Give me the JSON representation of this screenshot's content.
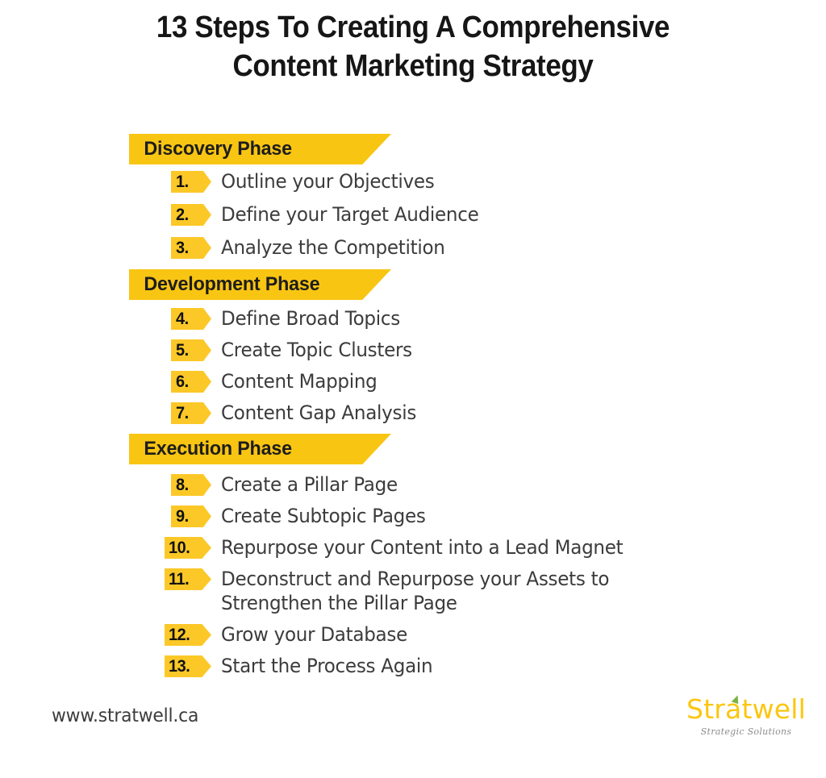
{
  "title": {
    "line1": "13 Steps To Creating A Comprehensive",
    "line2": "Content Marketing Strategy"
  },
  "colors": {
    "banner_yellow": "#F9C513",
    "badge_yellow": "#FCC828",
    "title_black": "#161616",
    "body_gray": "#3C3C3E",
    "logo_gold": "#FAC711",
    "logo_leaf_green": "#7CB342",
    "tagline_gray": "#8D8D8D",
    "background": "#FFFFFF"
  },
  "phases": [
    {
      "label": "Discovery Phase",
      "steps": [
        {
          "num": "1.",
          "text": "Outline your Objectives"
        },
        {
          "num": "2.",
          "text": "Define your Target Audience"
        },
        {
          "num": "3.",
          "text": "Analyze the Competition"
        }
      ]
    },
    {
      "label": "Development Phase",
      "steps": [
        {
          "num": "4.",
          "text": "Define Broad Topics"
        },
        {
          "num": "5.",
          "text": "Create Topic Clusters"
        },
        {
          "num": "6.",
          "text": "Content Mapping"
        },
        {
          "num": "7.",
          "text": "Content Gap Analysis"
        }
      ]
    },
    {
      "label": "Execution Phase",
      "steps": [
        {
          "num": "8.",
          "text": "Create a Pillar Page"
        },
        {
          "num": "9.",
          "text": "Create Subtopic Pages"
        },
        {
          "num": "10.",
          "text": "Repurpose your Content into a Lead Magnet"
        },
        {
          "num": "11.",
          "text": "Deconstruct and Repurpose your Assets to\n Strengthen the Pillar Page"
        },
        {
          "num": "12.",
          "text": "Grow your Database"
        },
        {
          "num": "13.",
          "text": "Start the Process Again"
        }
      ]
    }
  ],
  "footer": {
    "url": "www.stratwell.ca",
    "logo_word": "Stratwell",
    "logo_tagline": "Strategic Solutions"
  }
}
